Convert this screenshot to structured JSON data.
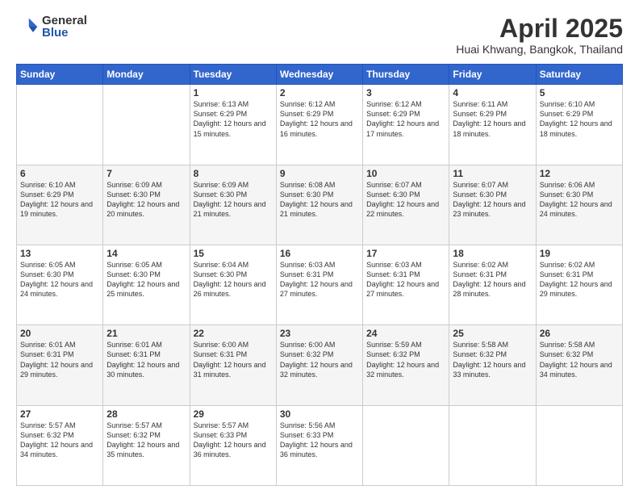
{
  "header": {
    "logo_general": "General",
    "logo_blue": "Blue",
    "month_title": "April 2025",
    "location": "Huai Khwang, Bangkok, Thailand"
  },
  "days_of_week": [
    "Sunday",
    "Monday",
    "Tuesday",
    "Wednesday",
    "Thursday",
    "Friday",
    "Saturday"
  ],
  "weeks": [
    [
      {
        "day": "",
        "info": ""
      },
      {
        "day": "",
        "info": ""
      },
      {
        "day": "1",
        "info": "Sunrise: 6:13 AM\nSunset: 6:29 PM\nDaylight: 12 hours and 15 minutes."
      },
      {
        "day": "2",
        "info": "Sunrise: 6:12 AM\nSunset: 6:29 PM\nDaylight: 12 hours and 16 minutes."
      },
      {
        "day": "3",
        "info": "Sunrise: 6:12 AM\nSunset: 6:29 PM\nDaylight: 12 hours and 17 minutes."
      },
      {
        "day": "4",
        "info": "Sunrise: 6:11 AM\nSunset: 6:29 PM\nDaylight: 12 hours and 18 minutes."
      },
      {
        "day": "5",
        "info": "Sunrise: 6:10 AM\nSunset: 6:29 PM\nDaylight: 12 hours and 18 minutes."
      }
    ],
    [
      {
        "day": "6",
        "info": "Sunrise: 6:10 AM\nSunset: 6:29 PM\nDaylight: 12 hours and 19 minutes."
      },
      {
        "day": "7",
        "info": "Sunrise: 6:09 AM\nSunset: 6:30 PM\nDaylight: 12 hours and 20 minutes."
      },
      {
        "day": "8",
        "info": "Sunrise: 6:09 AM\nSunset: 6:30 PM\nDaylight: 12 hours and 21 minutes."
      },
      {
        "day": "9",
        "info": "Sunrise: 6:08 AM\nSunset: 6:30 PM\nDaylight: 12 hours and 21 minutes."
      },
      {
        "day": "10",
        "info": "Sunrise: 6:07 AM\nSunset: 6:30 PM\nDaylight: 12 hours and 22 minutes."
      },
      {
        "day": "11",
        "info": "Sunrise: 6:07 AM\nSunset: 6:30 PM\nDaylight: 12 hours and 23 minutes."
      },
      {
        "day": "12",
        "info": "Sunrise: 6:06 AM\nSunset: 6:30 PM\nDaylight: 12 hours and 24 minutes."
      }
    ],
    [
      {
        "day": "13",
        "info": "Sunrise: 6:05 AM\nSunset: 6:30 PM\nDaylight: 12 hours and 24 minutes."
      },
      {
        "day": "14",
        "info": "Sunrise: 6:05 AM\nSunset: 6:30 PM\nDaylight: 12 hours and 25 minutes."
      },
      {
        "day": "15",
        "info": "Sunrise: 6:04 AM\nSunset: 6:30 PM\nDaylight: 12 hours and 26 minutes."
      },
      {
        "day": "16",
        "info": "Sunrise: 6:03 AM\nSunset: 6:31 PM\nDaylight: 12 hours and 27 minutes."
      },
      {
        "day": "17",
        "info": "Sunrise: 6:03 AM\nSunset: 6:31 PM\nDaylight: 12 hours and 27 minutes."
      },
      {
        "day": "18",
        "info": "Sunrise: 6:02 AM\nSunset: 6:31 PM\nDaylight: 12 hours and 28 minutes."
      },
      {
        "day": "19",
        "info": "Sunrise: 6:02 AM\nSunset: 6:31 PM\nDaylight: 12 hours and 29 minutes."
      }
    ],
    [
      {
        "day": "20",
        "info": "Sunrise: 6:01 AM\nSunset: 6:31 PM\nDaylight: 12 hours and 29 minutes."
      },
      {
        "day": "21",
        "info": "Sunrise: 6:01 AM\nSunset: 6:31 PM\nDaylight: 12 hours and 30 minutes."
      },
      {
        "day": "22",
        "info": "Sunrise: 6:00 AM\nSunset: 6:31 PM\nDaylight: 12 hours and 31 minutes."
      },
      {
        "day": "23",
        "info": "Sunrise: 6:00 AM\nSunset: 6:32 PM\nDaylight: 12 hours and 32 minutes."
      },
      {
        "day": "24",
        "info": "Sunrise: 5:59 AM\nSunset: 6:32 PM\nDaylight: 12 hours and 32 minutes."
      },
      {
        "day": "25",
        "info": "Sunrise: 5:58 AM\nSunset: 6:32 PM\nDaylight: 12 hours and 33 minutes."
      },
      {
        "day": "26",
        "info": "Sunrise: 5:58 AM\nSunset: 6:32 PM\nDaylight: 12 hours and 34 minutes."
      }
    ],
    [
      {
        "day": "27",
        "info": "Sunrise: 5:57 AM\nSunset: 6:32 PM\nDaylight: 12 hours and 34 minutes."
      },
      {
        "day": "28",
        "info": "Sunrise: 5:57 AM\nSunset: 6:32 PM\nDaylight: 12 hours and 35 minutes."
      },
      {
        "day": "29",
        "info": "Sunrise: 5:57 AM\nSunset: 6:33 PM\nDaylight: 12 hours and 36 minutes."
      },
      {
        "day": "30",
        "info": "Sunrise: 5:56 AM\nSunset: 6:33 PM\nDaylight: 12 hours and 36 minutes."
      },
      {
        "day": "",
        "info": ""
      },
      {
        "day": "",
        "info": ""
      },
      {
        "day": "",
        "info": ""
      }
    ]
  ]
}
